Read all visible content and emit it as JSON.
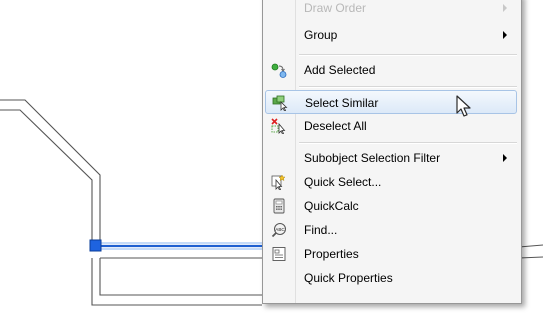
{
  "menu": {
    "items": [
      {
        "label": "Draw Order",
        "submenu": true,
        "dim": true
      },
      {
        "label": "Group",
        "submenu": true
      },
      {
        "label": "Add Selected",
        "icon": "add-selected-icon"
      },
      {
        "label": "Select Similar",
        "icon": "select-similar-icon",
        "highlighted": true
      },
      {
        "label": "Deselect All",
        "icon": "deselect-all-icon"
      },
      {
        "label": "Subobject Selection Filter",
        "submenu": true
      },
      {
        "label": "Quick Select...",
        "icon": "quick-select-icon"
      },
      {
        "label": "QuickCalc",
        "icon": "calculator-icon"
      },
      {
        "label": "Find...",
        "icon": "find-icon"
      },
      {
        "label": "Properties",
        "icon": "properties-icon"
      },
      {
        "label": "Quick Properties"
      }
    ]
  },
  "colors": {
    "selected_line": "#2f6fd6",
    "grip": "#1e63e0",
    "menu_bg": "#f5f5f5",
    "highlight_border": "#a8c4e6"
  }
}
